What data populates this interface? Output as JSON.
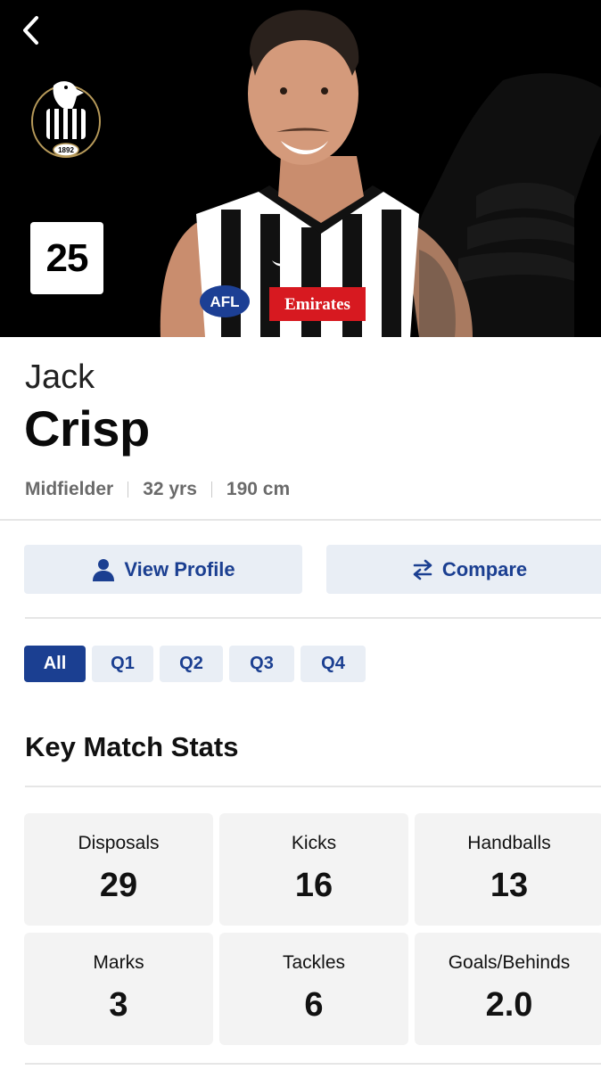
{
  "player": {
    "number": "25",
    "first_name": "Jack",
    "last_name": "Crisp",
    "position": "Midfielder",
    "age": "32 yrs",
    "height": "190 cm"
  },
  "hero": {
    "logo_year": "1892",
    "jersey_brand": "AFL",
    "jersey_sponsor": "Emirates"
  },
  "actions": {
    "view_profile": "View Profile",
    "compare": "Compare"
  },
  "tabs": [
    {
      "label": "All",
      "active": true
    },
    {
      "label": "Q1",
      "active": false
    },
    {
      "label": "Q2",
      "active": false
    },
    {
      "label": "Q3",
      "active": false
    },
    {
      "label": "Q4",
      "active": false
    }
  ],
  "section_title": "Key Match Stats",
  "stats": [
    {
      "label": "Disposals",
      "value": "29"
    },
    {
      "label": "Kicks",
      "value": "16"
    },
    {
      "label": "Handballs",
      "value": "13"
    },
    {
      "label": "Marks",
      "value": "3"
    },
    {
      "label": "Tackles",
      "value": "6"
    },
    {
      "label": "Goals/Behinds",
      "value": "2.0"
    }
  ],
  "colors": {
    "accent": "#1b3f91",
    "button_bg": "#e9eef5",
    "card_bg": "#f3f3f3",
    "hero_bg": "#000000",
    "meta_text": "#6a6a6a"
  },
  "icons": {
    "back": "chevron-left-icon",
    "profile": "person-icon",
    "compare": "swap-arrows-icon"
  }
}
